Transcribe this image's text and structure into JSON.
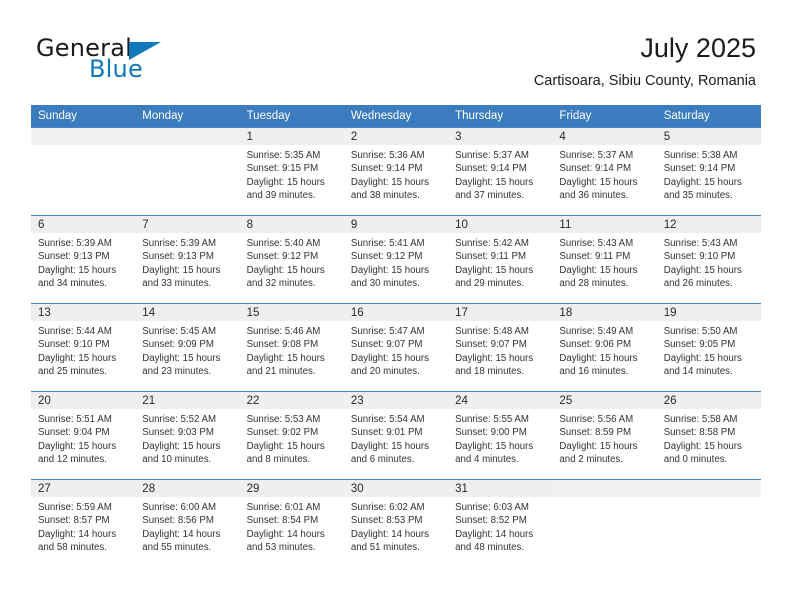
{
  "brand": {
    "name_dark": "General",
    "name_blue": "Blue",
    "triangle_icon": "triangle-icon",
    "accent_color": "#1278be"
  },
  "header": {
    "title": "July 2025",
    "subtitle": "Cartisoara, Sibiu County, Romania"
  },
  "colors": {
    "header_blue": "#3b7cbf",
    "row_divider": "#4a86c5",
    "date_band": "#efefef"
  },
  "weekdays": [
    "Sunday",
    "Monday",
    "Tuesday",
    "Wednesday",
    "Thursday",
    "Friday",
    "Saturday"
  ],
  "weeks": [
    [
      {
        "day": "",
        "blank": true
      },
      {
        "day": "",
        "blank": true
      },
      {
        "day": "1",
        "sunrise": "Sunrise: 5:35 AM",
        "sunset": "Sunset: 9:15 PM",
        "daylight_1": "Daylight: 15 hours",
        "daylight_2": "and 39 minutes."
      },
      {
        "day": "2",
        "sunrise": "Sunrise: 5:36 AM",
        "sunset": "Sunset: 9:14 PM",
        "daylight_1": "Daylight: 15 hours",
        "daylight_2": "and 38 minutes."
      },
      {
        "day": "3",
        "sunrise": "Sunrise: 5:37 AM",
        "sunset": "Sunset: 9:14 PM",
        "daylight_1": "Daylight: 15 hours",
        "daylight_2": "and 37 minutes."
      },
      {
        "day": "4",
        "sunrise": "Sunrise: 5:37 AM",
        "sunset": "Sunset: 9:14 PM",
        "daylight_1": "Daylight: 15 hours",
        "daylight_2": "and 36 minutes."
      },
      {
        "day": "5",
        "sunrise": "Sunrise: 5:38 AM",
        "sunset": "Sunset: 9:14 PM",
        "daylight_1": "Daylight: 15 hours",
        "daylight_2": "and 35 minutes."
      }
    ],
    [
      {
        "day": "6",
        "sunrise": "Sunrise: 5:39 AM",
        "sunset": "Sunset: 9:13 PM",
        "daylight_1": "Daylight: 15 hours",
        "daylight_2": "and 34 minutes."
      },
      {
        "day": "7",
        "sunrise": "Sunrise: 5:39 AM",
        "sunset": "Sunset: 9:13 PM",
        "daylight_1": "Daylight: 15 hours",
        "daylight_2": "and 33 minutes."
      },
      {
        "day": "8",
        "sunrise": "Sunrise: 5:40 AM",
        "sunset": "Sunset: 9:12 PM",
        "daylight_1": "Daylight: 15 hours",
        "daylight_2": "and 32 minutes."
      },
      {
        "day": "9",
        "sunrise": "Sunrise: 5:41 AM",
        "sunset": "Sunset: 9:12 PM",
        "daylight_1": "Daylight: 15 hours",
        "daylight_2": "and 30 minutes."
      },
      {
        "day": "10",
        "sunrise": "Sunrise: 5:42 AM",
        "sunset": "Sunset: 9:11 PM",
        "daylight_1": "Daylight: 15 hours",
        "daylight_2": "and 29 minutes."
      },
      {
        "day": "11",
        "sunrise": "Sunrise: 5:43 AM",
        "sunset": "Sunset: 9:11 PM",
        "daylight_1": "Daylight: 15 hours",
        "daylight_2": "and 28 minutes."
      },
      {
        "day": "12",
        "sunrise": "Sunrise: 5:43 AM",
        "sunset": "Sunset: 9:10 PM",
        "daylight_1": "Daylight: 15 hours",
        "daylight_2": "and 26 minutes."
      }
    ],
    [
      {
        "day": "13",
        "sunrise": "Sunrise: 5:44 AM",
        "sunset": "Sunset: 9:10 PM",
        "daylight_1": "Daylight: 15 hours",
        "daylight_2": "and 25 minutes."
      },
      {
        "day": "14",
        "sunrise": "Sunrise: 5:45 AM",
        "sunset": "Sunset: 9:09 PM",
        "daylight_1": "Daylight: 15 hours",
        "daylight_2": "and 23 minutes."
      },
      {
        "day": "15",
        "sunrise": "Sunrise: 5:46 AM",
        "sunset": "Sunset: 9:08 PM",
        "daylight_1": "Daylight: 15 hours",
        "daylight_2": "and 21 minutes."
      },
      {
        "day": "16",
        "sunrise": "Sunrise: 5:47 AM",
        "sunset": "Sunset: 9:07 PM",
        "daylight_1": "Daylight: 15 hours",
        "daylight_2": "and 20 minutes."
      },
      {
        "day": "17",
        "sunrise": "Sunrise: 5:48 AM",
        "sunset": "Sunset: 9:07 PM",
        "daylight_1": "Daylight: 15 hours",
        "daylight_2": "and 18 minutes."
      },
      {
        "day": "18",
        "sunrise": "Sunrise: 5:49 AM",
        "sunset": "Sunset: 9:06 PM",
        "daylight_1": "Daylight: 15 hours",
        "daylight_2": "and 16 minutes."
      },
      {
        "day": "19",
        "sunrise": "Sunrise: 5:50 AM",
        "sunset": "Sunset: 9:05 PM",
        "daylight_1": "Daylight: 15 hours",
        "daylight_2": "and 14 minutes."
      }
    ],
    [
      {
        "day": "20",
        "sunrise": "Sunrise: 5:51 AM",
        "sunset": "Sunset: 9:04 PM",
        "daylight_1": "Daylight: 15 hours",
        "daylight_2": "and 12 minutes."
      },
      {
        "day": "21",
        "sunrise": "Sunrise: 5:52 AM",
        "sunset": "Sunset: 9:03 PM",
        "daylight_1": "Daylight: 15 hours",
        "daylight_2": "and 10 minutes."
      },
      {
        "day": "22",
        "sunrise": "Sunrise: 5:53 AM",
        "sunset": "Sunset: 9:02 PM",
        "daylight_1": "Daylight: 15 hours",
        "daylight_2": "and 8 minutes."
      },
      {
        "day": "23",
        "sunrise": "Sunrise: 5:54 AM",
        "sunset": "Sunset: 9:01 PM",
        "daylight_1": "Daylight: 15 hours",
        "daylight_2": "and 6 minutes."
      },
      {
        "day": "24",
        "sunrise": "Sunrise: 5:55 AM",
        "sunset": "Sunset: 9:00 PM",
        "daylight_1": "Daylight: 15 hours",
        "daylight_2": "and 4 minutes."
      },
      {
        "day": "25",
        "sunrise": "Sunrise: 5:56 AM",
        "sunset": "Sunset: 8:59 PM",
        "daylight_1": "Daylight: 15 hours",
        "daylight_2": "and 2 minutes."
      },
      {
        "day": "26",
        "sunrise": "Sunrise: 5:58 AM",
        "sunset": "Sunset: 8:58 PM",
        "daylight_1": "Daylight: 15 hours",
        "daylight_2": "and 0 minutes."
      }
    ],
    [
      {
        "day": "27",
        "sunrise": "Sunrise: 5:59 AM",
        "sunset": "Sunset: 8:57 PM",
        "daylight_1": "Daylight: 14 hours",
        "daylight_2": "and 58 minutes."
      },
      {
        "day": "28",
        "sunrise": "Sunrise: 6:00 AM",
        "sunset": "Sunset: 8:56 PM",
        "daylight_1": "Daylight: 14 hours",
        "daylight_2": "and 55 minutes."
      },
      {
        "day": "29",
        "sunrise": "Sunrise: 6:01 AM",
        "sunset": "Sunset: 8:54 PM",
        "daylight_1": "Daylight: 14 hours",
        "daylight_2": "and 53 minutes."
      },
      {
        "day": "30",
        "sunrise": "Sunrise: 6:02 AM",
        "sunset": "Sunset: 8:53 PM",
        "daylight_1": "Daylight: 14 hours",
        "daylight_2": "and 51 minutes."
      },
      {
        "day": "31",
        "sunrise": "Sunrise: 6:03 AM",
        "sunset": "Sunset: 8:52 PM",
        "daylight_1": "Daylight: 14 hours",
        "daylight_2": "and 48 minutes."
      },
      {
        "day": "",
        "blank": true
      },
      {
        "day": "",
        "blank": true
      }
    ]
  ]
}
